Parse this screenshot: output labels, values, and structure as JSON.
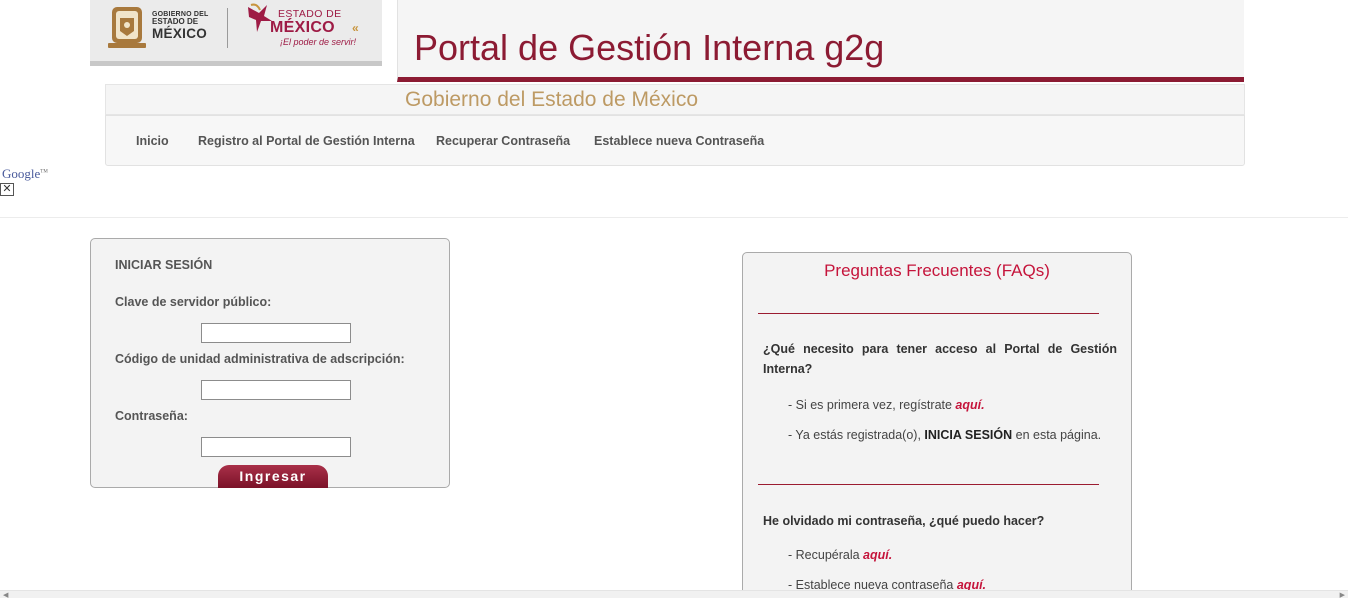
{
  "header": {
    "logo_gob": {
      "small": "GOBIERNO DEL",
      "mid": "ESTADO DE",
      "big": "MÉXICO"
    },
    "logo_edo": {
      "line1": "ESTADO DE",
      "line2": "MÉXICO",
      "slogan": "¡El poder de servir!"
    },
    "title": "Portal de Gestión Interna g2g",
    "subtitle": "Gobierno del Estado de México"
  },
  "nav": {
    "items": [
      {
        "label": "Inicio"
      },
      {
        "label": "Registro al Portal de Gestión Interna"
      },
      {
        "label": "Recuperar Contraseña"
      },
      {
        "label": "Establece nueva Contraseña"
      }
    ]
  },
  "google": {
    "label": "Google",
    "tm": "TM"
  },
  "login": {
    "title": "INICIAR SESIÓN",
    "field1_label": "Clave de servidor público:",
    "field1_value": "",
    "field2_label": "Código de unidad administrativa de adscripción:",
    "field2_value": "",
    "field3_label": "Contraseña:",
    "field3_value": "",
    "submit_label": "Ingresar"
  },
  "faq": {
    "title": "Preguntas Frecuentes (FAQs)",
    "q1": "¿Qué necesito para tener acceso al Portal de Gestión Interna?",
    "q1_a1_text": "- Si es primera vez, regístrate ",
    "q1_a1_link": "aquí.",
    "q1_a2_pre": "- Ya estás registrada(o), ",
    "q1_a2_bold": "INICIA SESIÓN",
    "q1_a2_post": " en esta página.",
    "q2": "He olvidado mi contraseña, ¿qué puedo hacer?",
    "q2_a1_text": "- Recupérala ",
    "q2_a1_link": "aquí.",
    "q2_a2_text": "- Establece nueva contraseña ",
    "q2_a2_link": "aquí."
  },
  "colors": {
    "brand": "#8c1b33",
    "gold": "#bd9a64",
    "link": "#c5143b"
  }
}
